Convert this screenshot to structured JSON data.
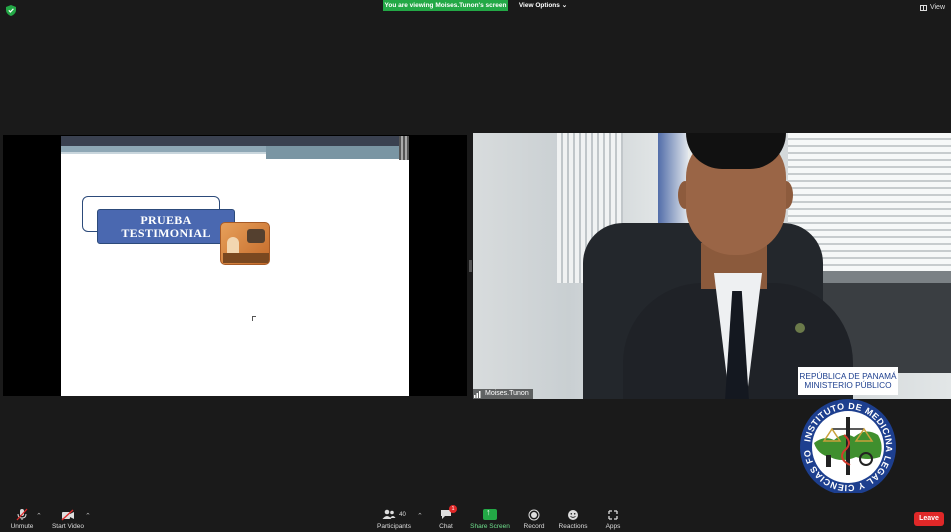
{
  "top_bar": {
    "viewing_banner": "You are viewing Moises.Tunon's screen",
    "view_options_label": "View Options",
    "view_label": "View"
  },
  "shared_slide": {
    "title_line1": "PRUEBA",
    "title_line2": "TESTIMONIAL"
  },
  "video": {
    "participant_name": "Moises.Tunon"
  },
  "seal": {
    "top_line1": "REPÚBLICA DE PANAMÁ",
    "top_line2": "MINISTERIO PÚBLICO",
    "ring_text": "INSTITUTO DE MEDICINA LEGAL Y CIENCIAS FORENSES"
  },
  "toolbar": {
    "unmute_label": "Unmute",
    "start_video_label": "Start Video",
    "participants_label": "Participants",
    "participants_count": "40",
    "chat_label": "Chat",
    "chat_badge": "1",
    "share_screen_label": "Share Screen",
    "record_label": "Record",
    "reactions_label": "Reactions",
    "apps_label": "Apps",
    "leave_label": "Leave"
  },
  "colors": {
    "banner_green": "#23a846",
    "leave_red": "#e02828",
    "slide_blue": "#4a68b0"
  }
}
